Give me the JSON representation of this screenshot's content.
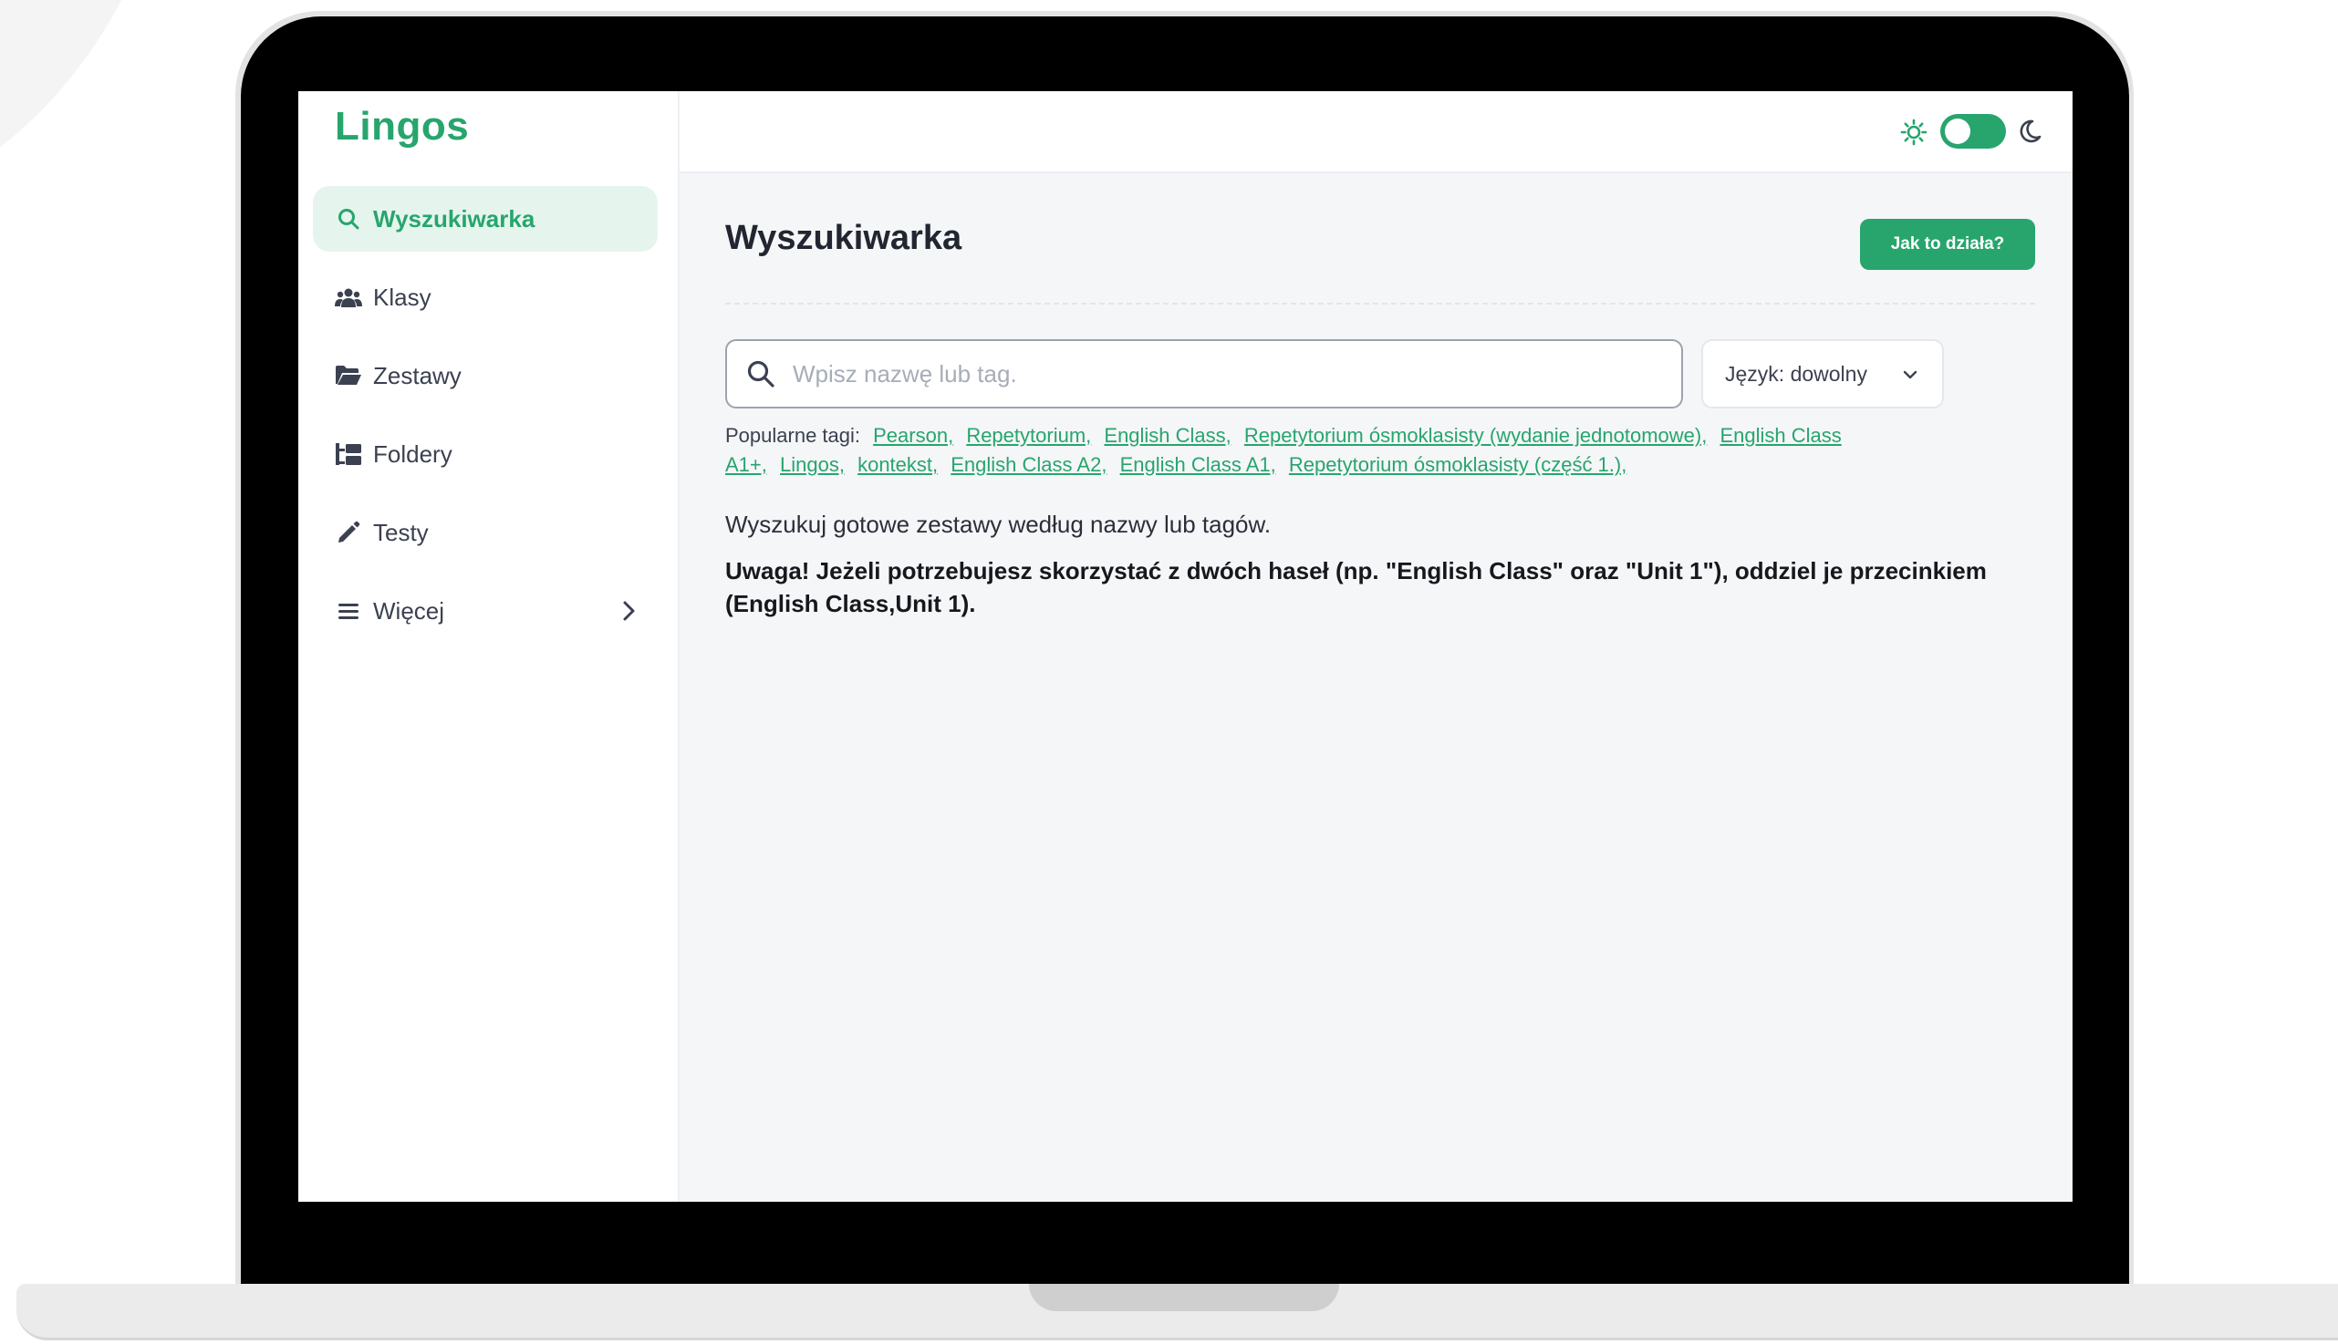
{
  "app": {
    "logo": "Lingos"
  },
  "sidebar": {
    "items": [
      {
        "label": "Wyszukiwarka",
        "icon": "search-icon",
        "active": true
      },
      {
        "label": "Klasy",
        "icon": "users-icon",
        "active": false
      },
      {
        "label": "Zestawy",
        "icon": "folder-open-icon",
        "active": false
      },
      {
        "label": "Foldery",
        "icon": "folder-tree-icon",
        "active": false
      },
      {
        "label": "Testy",
        "icon": "pencil-icon",
        "active": false
      },
      {
        "label": "Więcej",
        "icon": "menu-icon",
        "active": false,
        "has_submenu": true
      }
    ]
  },
  "topbar": {
    "theme_toggle_on": true,
    "icons": [
      "sun-icon",
      "moon-icon"
    ]
  },
  "main": {
    "title": "Wyszukiwarka",
    "help_button": "Jak to działa?",
    "search": {
      "placeholder": "Wpisz nazwę lub tag."
    },
    "language_select": {
      "selected": "Język: dowolny"
    },
    "popular_tags_label": "Popularne tagi:",
    "popular_tags": [
      "Pearson,",
      "Repetytorium,",
      "English Class,",
      "Repetytorium ósmoklasisty (wydanie jednotomowe),",
      "English Class",
      "A1+,",
      "Lingos,",
      "kontekst,",
      "English Class A2,",
      "English Class A1,",
      "Repetytorium ósmoklasisty (część 1.),"
    ],
    "description": "Wyszukuj gotowe zestawy według nazwy lub tagów.",
    "warning": "Uwaga! Jeżeli potrzebujesz skorzystać z dwóch haseł (np. \"English Class\" oraz \"Unit 1\"), oddziel je przecinkiem (English Class,Unit 1)."
  },
  "colors": {
    "accent": "#27a56d",
    "accent_light": "#e5f5ee",
    "main_bg": "#f5f6f8"
  }
}
